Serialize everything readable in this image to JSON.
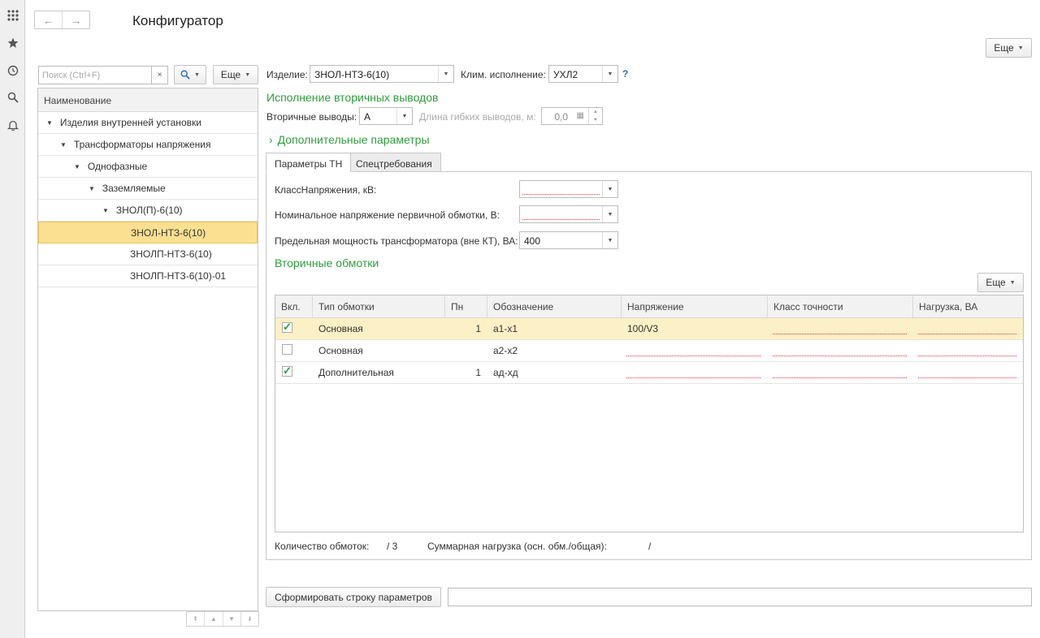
{
  "app": {
    "title": "Конфигуратор"
  },
  "sidebar_icons": [
    {
      "name": "apps-grid-icon",
      "glyph": "⋮⋮⋮"
    },
    {
      "name": "favorites-star-icon",
      "glyph": "★"
    },
    {
      "name": "history-icon",
      "glyph": "⟲"
    },
    {
      "name": "search-icon",
      "glyph": "⌕"
    },
    {
      "name": "notifications-bell-icon",
      "glyph": "🔔"
    }
  ],
  "nav": {
    "back": "←",
    "forward": "→"
  },
  "header": {
    "more_label": "Еще"
  },
  "tree_panel": {
    "search_placeholder": "Поиск (Ctrl+F)",
    "clear": "×",
    "search_btn": "🔍",
    "more_label": "Еще",
    "column_header": "Наименование",
    "items": [
      {
        "label": "Изделия внутренней установки",
        "expanded": true
      },
      {
        "label": "Трансформаторы напряжения",
        "expanded": true
      },
      {
        "label": "Однофазные",
        "expanded": true
      },
      {
        "label": "Заземляемые",
        "expanded": true
      },
      {
        "label": "ЗНОЛ(П)-6(10)",
        "expanded": true
      },
      {
        "label": "ЗНОЛ-НТЗ-6(10)",
        "selected": true
      },
      {
        "label": "ЗНОЛП-НТЗ-6(10)"
      },
      {
        "label": "ЗНОЛП-НТЗ-6(10)-01"
      }
    ],
    "scroll_buttons": [
      "⇞",
      "▲",
      "▼",
      "⇟"
    ]
  },
  "form": {
    "product_label": "Изделие:",
    "product_value": "ЗНОЛ-НТЗ-6(10)",
    "climate_label": "Клим. исполнение:",
    "climate_value": "УХЛ2",
    "help": "?",
    "secondary_outputs_heading": "Исполнение вторичных выводов",
    "secondary_outputs_label": "Вторичные выводы:",
    "secondary_outputs_value": "А",
    "flex_length_label": "Длина гибких выводов, м:",
    "flex_length_value": "0,0",
    "additional_params": "Дополнительные параметры",
    "tabs": [
      "Параметры ТН",
      "Спецтребования"
    ],
    "voltage_class_label": "КлассНапряжения, кВ:",
    "voltage_class_value": "",
    "nominal_voltage_label": "Номинальное напряжение первичной обмотки, В:",
    "nominal_voltage_value": "",
    "max_power_label": "Предельная мощность трансформатора (вне КТ), ВА:",
    "max_power_value": "400",
    "windings_heading": "Вторичные обмотки",
    "windings_more": "Еще"
  },
  "windings_table": {
    "columns": [
      "Вкл.",
      "Тип обмотки",
      "Пн",
      "Обозначение",
      "Напряжение",
      "Класс точности",
      "Нагрузка, ВА"
    ],
    "rows": [
      {
        "enabled": true,
        "type": "Основная",
        "pn": "1",
        "designation": "а1-х1",
        "voltage": "100/V3",
        "accuracy": "",
        "load": "",
        "selected": true
      },
      {
        "enabled": false,
        "type": "Основная",
        "pn": "",
        "designation": "а2-х2",
        "voltage": "",
        "accuracy": "",
        "load": ""
      },
      {
        "enabled": true,
        "type": "Дополнительная",
        "pn": "1",
        "designation": "ад-хд",
        "voltage": "",
        "accuracy": "",
        "load": ""
      }
    ]
  },
  "summary": {
    "count_label": "Количество обмоток:",
    "count_value": "/  3",
    "load_label": "Суммарная нагрузка (осн. обм./общая):",
    "load_value": "/"
  },
  "footer": {
    "generate_label": "Сформировать строку параметров",
    "result_value": ""
  },
  "colors": {
    "accent_green": "#2f9c3e",
    "selection": "#fbe091",
    "required_marker": "#e03030"
  }
}
